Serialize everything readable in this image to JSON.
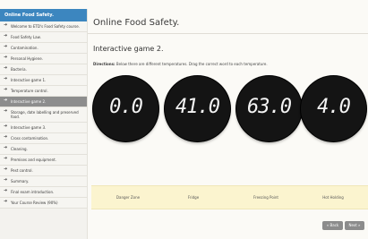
{
  "sidebar": {
    "header": "Online Food Safety.",
    "items": [
      {
        "label": "Welcome to ETD's Food Safety course."
      },
      {
        "label": "Food Safety Law."
      },
      {
        "label": "Contamination."
      },
      {
        "label": "Personal Hygiene."
      },
      {
        "label": "Bacteria."
      },
      {
        "label": "Interactive game 1."
      },
      {
        "label": "Temperature control."
      },
      {
        "label": "Interactive game 2."
      },
      {
        "label": "Storage, date labelling and preserved food."
      },
      {
        "label": "Interactive game 3."
      },
      {
        "label": "Cross contamination."
      },
      {
        "label": "Cleaning."
      },
      {
        "label": "Premises and equipment."
      },
      {
        "label": "Pest control."
      },
      {
        "label": "Summary."
      },
      {
        "label": "Final exam introduction."
      },
      {
        "label": "Your Course Review (90%)"
      }
    ],
    "active_index": 7
  },
  "main": {
    "title": "Online Food Safety.",
    "section_title": "Interactive game 2.",
    "directions_label": "Directions:",
    "directions_text": "Below there are different temperatures. Drag the correct word to each temperature.",
    "temperatures": [
      "0.0",
      "41.0",
      "63.0",
      "4.0"
    ],
    "drop_labels": [
      "Danger Zone",
      "Fridge",
      "Freezing Point",
      "Hot Holding"
    ],
    "buttons": {
      "back": "« Back",
      "next": "Next »"
    }
  },
  "colors": {
    "header_blue": "#3c86bf",
    "active_item": "#8d8d8d",
    "drop_bar": "#fbf4cf",
    "dial": "#141414"
  }
}
